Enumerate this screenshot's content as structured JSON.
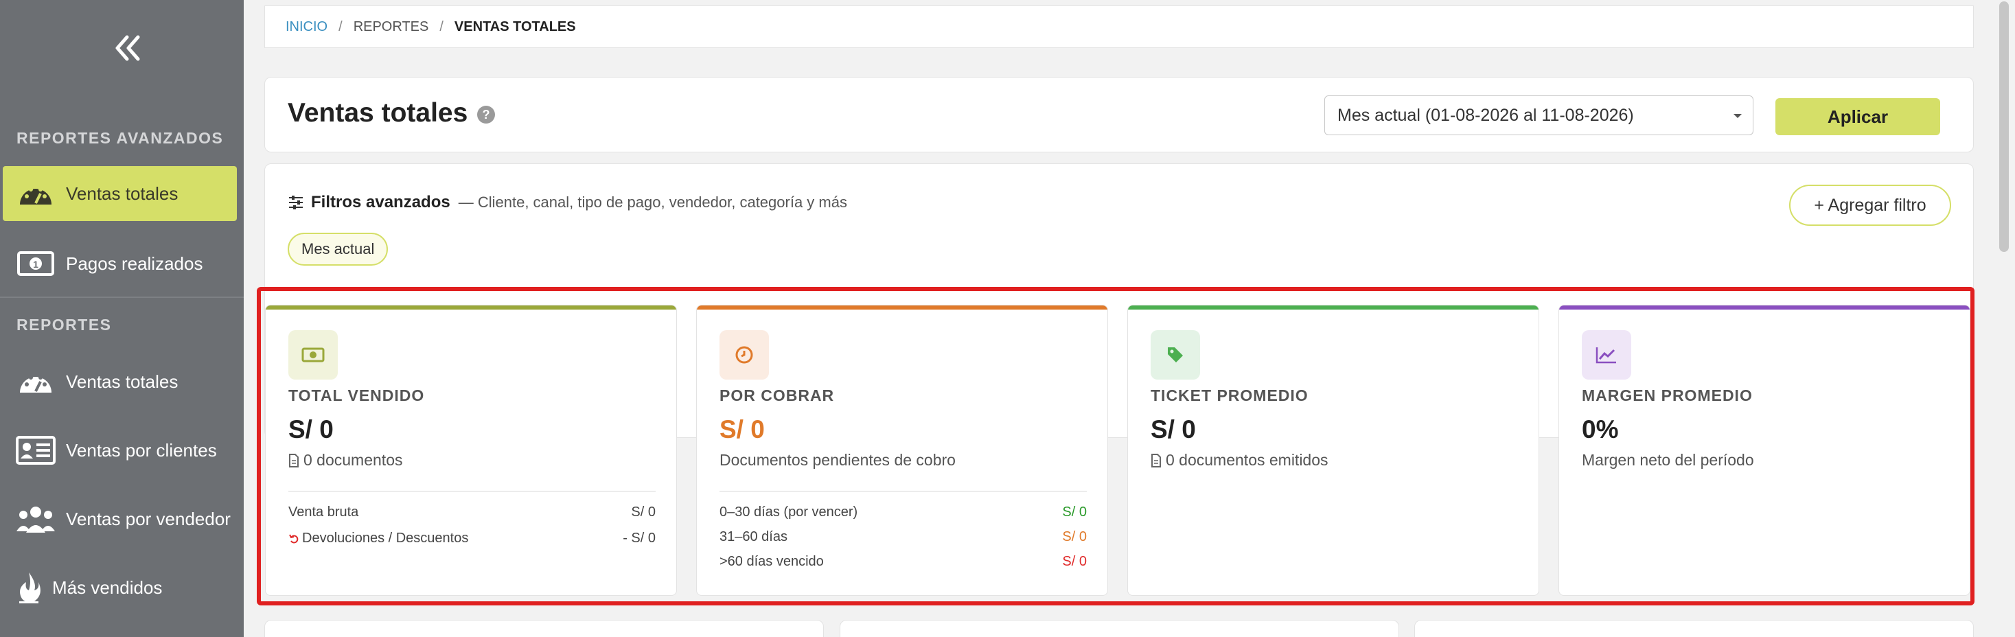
{
  "sidebar": {
    "sections": {
      "advanced": "REPORTES AVANZADOS",
      "reports": "REPORTES"
    },
    "items": [
      {
        "label": "Ventas totales",
        "icon": "speedometer-icon"
      },
      {
        "label": "Pagos realizados",
        "icon": "cash-icon"
      },
      {
        "label": "Ventas totales",
        "icon": "speedometer-icon"
      },
      {
        "label": "Ventas por clientes",
        "icon": "id-card-icon"
      },
      {
        "label": "Ventas por vendedor",
        "icon": "users-icon"
      },
      {
        "label": "Más vendidos",
        "icon": "fire-icon"
      }
    ]
  },
  "breadcrumb": {
    "home": "INICIO",
    "reports": "REPORTES",
    "current": "VENTAS TOTALES"
  },
  "header": {
    "title": "Ventas totales",
    "period_select": "Mes actual (01-08-2026 al 11-08-2026)",
    "apply_label": "Aplicar"
  },
  "filters": {
    "title": "Filtros avanzados",
    "description": "— Cliente, canal, tipo de pago, vendedor, categoría y más",
    "add_label": "+ Agregar filtro",
    "active_chip": "Mes actual"
  },
  "kpis": {
    "total": {
      "label": "TOTAL VENDIDO",
      "value": "S/ 0",
      "sub": "0 documentos",
      "rows": [
        {
          "label": "Venta bruta",
          "value": "S/ 0"
        },
        {
          "label": "Devoluciones / Descuentos",
          "value": "- S/ 0"
        }
      ]
    },
    "receivable": {
      "label": "POR COBRAR",
      "value": "S/ 0",
      "sub": "Documentos pendientes de cobro",
      "rows": [
        {
          "label": "0–30 días (por vencer)",
          "value": "S/ 0"
        },
        {
          "label": "31–60 días",
          "value": "S/ 0"
        },
        {
          "label": ">60 días vencido",
          "value": "S/ 0"
        }
      ]
    },
    "ticket": {
      "label": "TICKET PROMEDIO",
      "value": "S/ 0",
      "sub": "0 documentos emitidos"
    },
    "margin": {
      "label": "MARGEN PROMEDIO",
      "value": "0%",
      "sub": "Margen neto del período"
    }
  },
  "colors": {
    "accent": "#d5df68",
    "olive": "#9aa83a",
    "orange": "#e07a2a",
    "green": "#4caf50",
    "purple": "#8a4fc0",
    "highlight": "#e02020"
  }
}
